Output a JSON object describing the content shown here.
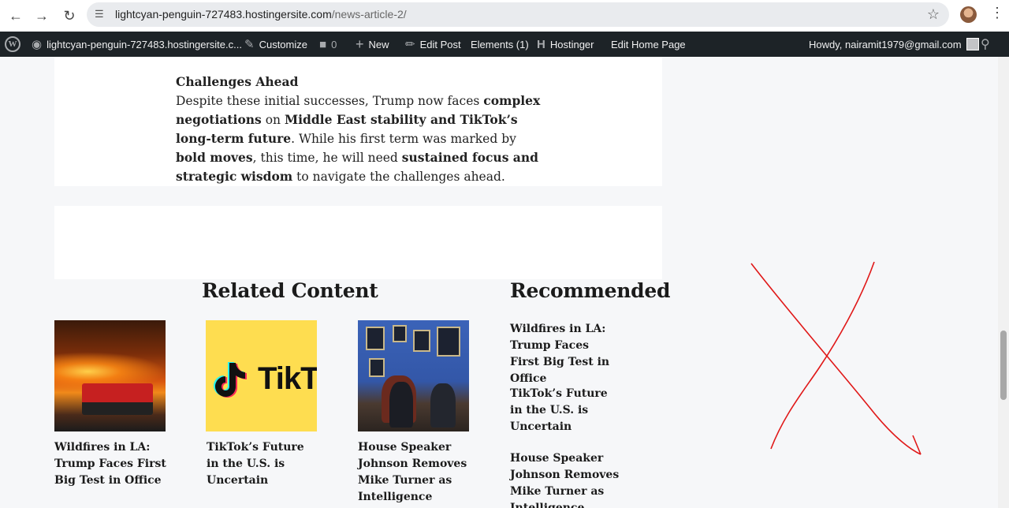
{
  "browser": {
    "back_icon": "arrow-left-icon",
    "forward_icon": "arrow-right-icon",
    "reload_icon": "reload-icon",
    "url_host": "lightcyan-penguin-727483.hostingersite.com",
    "url_path": "/news-article-2/"
  },
  "admin_bar": {
    "site": "lightcyan-penguin-727483.hostingersite.c...",
    "customize": "Customize",
    "comments_count": "0",
    "new": "New",
    "edit_post": "Edit Post",
    "elements": "Elements (1)",
    "hostinger": "Hostinger",
    "edit_home": "Edit Home Page",
    "howdy": "Howdy, nairamit1979@gmail.com"
  },
  "article": {
    "heading": "Challenges Ahead",
    "p1": "Despite these initial successes, Trump now faces ",
    "b1": "complex negotiations",
    "p2": " on ",
    "b2": "Middle East stability and TikTok’s long-term future",
    "p3": ". While his first term was marked by ",
    "b3": "bold moves",
    "p4": ", this time, he will need ",
    "b4": "sustained focus and strategic wisdom",
    "p5": " to navigate the challenges ahead."
  },
  "related": {
    "heading": "Related Content",
    "items": [
      {
        "title": "Wildfires in LA: Trump Faces First Big Test in Office"
      },
      {
        "title": "TikTok’s Future in the U.S. is Uncertain"
      },
      {
        "title": "House Speaker Johnson Removes Mike Turner as Intelligence"
      }
    ],
    "tiktok_wordmark": "TikT"
  },
  "recommended": {
    "heading": "Recommended",
    "items": [
      {
        "title": "Wildfires in LA: Trump Faces First Big Test in Office"
      },
      {
        "title": "TikTok’s Future in the U.S. is Uncertain"
      },
      {
        "title": "House Speaker Johnson Removes Mike Turner as Intelligence"
      }
    ]
  },
  "annotation_color": "#e01818"
}
